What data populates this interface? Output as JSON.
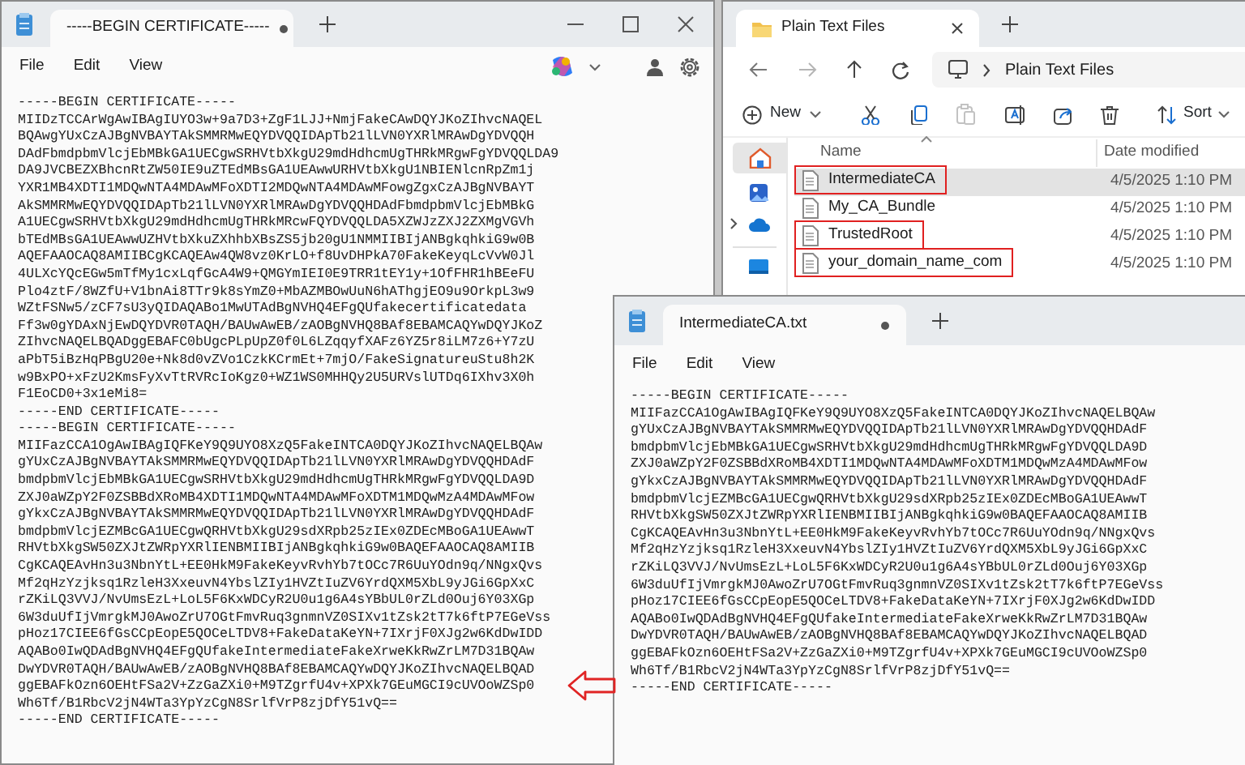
{
  "notepad_main": {
    "tab_title": "-----BEGIN CERTIFICATE-----",
    "unsaved": true,
    "menu": [
      "File",
      "Edit",
      "View"
    ],
    "lines": [
      "-----BEGIN CERTIFICATE-----",
      "MIIDzTCCArWgAwIBAgIUYO3w+9a7D3+ZgF1LJJ+NmjFakeCAwDQYJKoZIhvcNAQEL",
      "BQAwgYUxCzAJBgNVBAYTAkSMMRMwEQYDVQQIDApTb21lLVN0YXRlMRAwDgYDVQQH",
      "DAdFbmdpbmVlcjEbMBkGA1UECgwSRHVtbXkgU29mdHdhcmUgTHRkMRgwFgYDVQQLDA9",
      "DA9JVCBEZXBhcnRtZW50IE9uZTEdMBsGA1UEAwwURHVtbXkgU1NBIENlcnRpZm1j",
      "YXR1MB4XDTI1MDQwNTA4MDAwMFoXDTI2MDQwNTA4MDAwMFowgZgxCzAJBgNVBAYT",
      "AkSMMRMwEQYDVQQIDApTb21lLVN0YXRlMRAwDgYDVQQHDAdFbmdpbmVlcjEbMBkG",
      "A1UECgwSRHVtbXkgU29mdHdhcmUgTHRkMRcwFQYDVQQLDA5XZWJzZXJ2ZXMgVGVh",
      "bTEdMBsGA1UEAwwUZHVtbXkuZXhhbXBsZS5jb20gU1NMMIIBIjANBgkqhkiG9w0B",
      "AQEFAAOCAQ8AMIIBCgKCAQEAw4QW8vz0KrLO+f8UvDHPkA70FakeKeyqLcVvW0Jl",
      "4ULXcYQcEGw5mTfMy1cxLqfGcA4W9+QMGYmIEI0E9TRR1tEY1y+1OfFHR1hBEeFU",
      "Plo4ztF/8WZfU+V1bnAi8TTr9k8sYmZ0+MbAZMBOwUuN6hAThgjEO9u9OrkpL3w9",
      "WZtFSNw5/zCF7sU3yQIDAQABo1MwUTAdBgNVHQ4EFgQUfakecertificatedata",
      "Ff3w0gYDAxNjEwDQYDVR0TAQH/BAUwAwEB/zAOBgNVHQ8BAf8EBAMCAQYwDQYJKoZ",
      "ZIhvcNAQELBQADggEBAFC0bUgcPLpUpZ0f0L6LZqqyfXAFz6YZ5r8iLM7z6+Y7zU",
      "aPbT5iBzHqPBgU20e+Nk8d0vZVo1CzkKCrmEt+7mjO/FakeSignatureuStu8h2K",
      "w9BxPO+xFzU2KmsFyXvTtRVRcIoKgz0+WZ1WS0MHHQy2U5URVslUTDq6IXhv3X0h",
      "F1EoCD0+3x1eMi8=",
      "-----END CERTIFICATE-----",
      "-----BEGIN CERTIFICATE-----",
      "MIIFazCCA1OgAwIBAgIQFKeY9Q9UYO8XzQ5FakeINTCA0DQYJKoZIhvcNAQELBQAw",
      "gYUxCzAJBgNVBAYTAkSMMRMwEQYDVQQIDApTb21lLVN0YXRlMRAwDgYDVQQHDAdF",
      "bmdpbmVlcjEbMBkGA1UECgwSRHVtbXkgU29mdHdhcmUgTHRkMRgwFgYDVQQLDA9D",
      "ZXJ0aWZpY2F0ZSBBdXRoMB4XDTI1MDQwNTA4MDAwMFoXDTM1MDQwMzA4MDAwMFow",
      "gYkxCzAJBgNVBAYTAkSMMRMwEQYDVQQIDApTb21lLVN0YXRlMRAwDgYDVQQHDAdF",
      "bmdpbmVlcjEZMBcGA1UECgwQRHVtbXkgU29sdXRpb25zIEx0ZDEcMBoGA1UEAwwT",
      "RHVtbXkgSW50ZXJtZWRpYXRlIENBMIIBIjANBgkqhkiG9w0BAQEFAAOCAQ8AMIIB",
      "CgKCAQEAvHn3u3NbnYtL+EE0HkM9FakeKeyvRvhYb7tOCc7R6UuYOdn9q/NNgxQvs",
      "Mf2qHzYzjksq1RzleH3XxeuvN4YbslZIy1HVZtIuZV6YrdQXM5XbL9yJGi6GpXxC",
      "rZKiLQ3VVJ/NvUmsEzL+LoL5F6KxWDCyR2U0u1g6A4sYBbUL0rZLd0Ouj6Y03XGp",
      "6W3duUfIjVmrgkMJ0AwoZrU7OGtFmvRuq3gnmnVZ0SIXv1tZsk2tT7k6ftP7EGeVss",
      "pHoz17CIEE6fGsCCpEopE5QOCeLTDV8+FakeDataKeYN+7IXrjF0XJg2w6KdDwIDD",
      "AQABo0IwQDAdBgNVHQ4EFgQUfakeIntermediateFakeXrweKkRwZrLM7D31BQAw",
      "DwYDVR0TAQH/BAUwAwEB/zAOBgNVHQ8BAf8EBAMCAQYwDQYJKoZIhvcNAQELBQAD",
      "ggEBAFkOzn6OEHtFSa2V+ZzGaZXi0+M9TZgrfU4v+XPXk7GEuMGCI9cUVOoWZSp0",
      "Wh6Tf/B1RbcV2jN4WTa3YpYzCgN8SrlfVrP8zjDfY51vQ==",
      "-----END CERTIFICATE-----"
    ]
  },
  "file_explorer": {
    "tab_title": "Plain Text Files",
    "forward_enabled": false,
    "breadcrumb": "Plain Text Files",
    "toolbar": {
      "new": "New",
      "sort": "Sort",
      "paste_enabled": false
    },
    "columns": [
      "Name",
      "Date modified"
    ],
    "files": [
      {
        "name": "IntermediateCA",
        "date": "4/5/2025 1:10 PM",
        "selected": true,
        "outlined": true
      },
      {
        "name": "My_CA_Bundle",
        "date": "4/5/2025 1:10 PM",
        "selected": false,
        "outlined": false
      },
      {
        "name": "TrustedRoot",
        "date": "4/5/2025 1:10 PM",
        "selected": false,
        "outlined": true
      },
      {
        "name": "your_domain_name_com",
        "date": "4/5/2025 1:10 PM",
        "selected": false,
        "outlined": true
      }
    ]
  },
  "notepad_intermediate": {
    "tab_title": "IntermediateCA.txt",
    "unsaved": true,
    "menu": [
      "File",
      "Edit",
      "View"
    ],
    "lines": [
      "-----BEGIN CERTIFICATE-----",
      "MIIFazCCA1OgAwIBAgIQFKeY9Q9UYO8XzQ5FakeINTCA0DQYJKoZIhvcNAQELBQAw",
      "gYUxCzAJBgNVBAYTAkSMMRMwEQYDVQQIDApTb21lLVN0YXRlMRAwDgYDVQQHDAdF",
      "bmdpbmVlcjEbMBkGA1UECgwSRHVtbXkgU29mdHdhcmUgTHRkMRgwFgYDVQQLDA9D",
      "ZXJ0aWZpY2F0ZSBBdXRoMB4XDTI1MDQwNTA4MDAwMFoXDTM1MDQwMzA4MDAwMFow",
      "gYkxCzAJBgNVBAYTAkSMMRMwEQYDVQQIDApTb21lLVN0YXRlMRAwDgYDVQQHDAdF",
      "bmdpbmVlcjEZMBcGA1UECgwQRHVtbXkgU29sdXRpb25zIEx0ZDEcMBoGA1UEAwwT",
      "RHVtbXkgSW50ZXJtZWRpYXRlIENBMIIBIjANBgkqhkiG9w0BAQEFAAOCAQ8AMIIB",
      "CgKCAQEAvHn3u3NbnYtL+EE0HkM9FakeKeyvRvhYb7tOCc7R6UuYOdn9q/NNgxQvs",
      "Mf2qHzYzjksq1RzleH3XxeuvN4YbslZIy1HVZtIuZV6YrdQXM5XbL9yJGi6GpXxC",
      "rZKiLQ3VVJ/NvUmsEzL+LoL5F6KxWDCyR2U0u1g6A4sYBbUL0rZLd0Ouj6Y03XGp",
      "6W3duUfIjVmrgkMJ0AwoZrU7OGtFmvRuq3gnmnVZ0SIXv1tZsk2tT7k6ftP7EGeVss",
      "pHoz17CIEE6fGsCCpEopE5QOCeLTDV8+FakeDataKeYN+7IXrjF0XJg2w6KdDwIDD",
      "AQABo0IwQDAdBgNVHQ4EFgQUfakeIntermediateFakeXrweKkRwZrLM7D31BQAw",
      "DwYDVR0TAQH/BAUwAwEB/zAOBgNVHQ8BAf8EBAMCAQYwDQYJKoZIhvcNAQELBQAD",
      "ggEBAFkOzn6OEHtFSa2V+ZzGaZXi0+M9TZgrfU4v+XPXk7GEuMGCI9cUVOoWZSp0",
      "Wh6Tf/B1RbcV2jN4WTa3YpYzCgN8SrlfVrP8zjDfY51vQ==",
      "-----END CERTIFICATE-----"
    ]
  }
}
